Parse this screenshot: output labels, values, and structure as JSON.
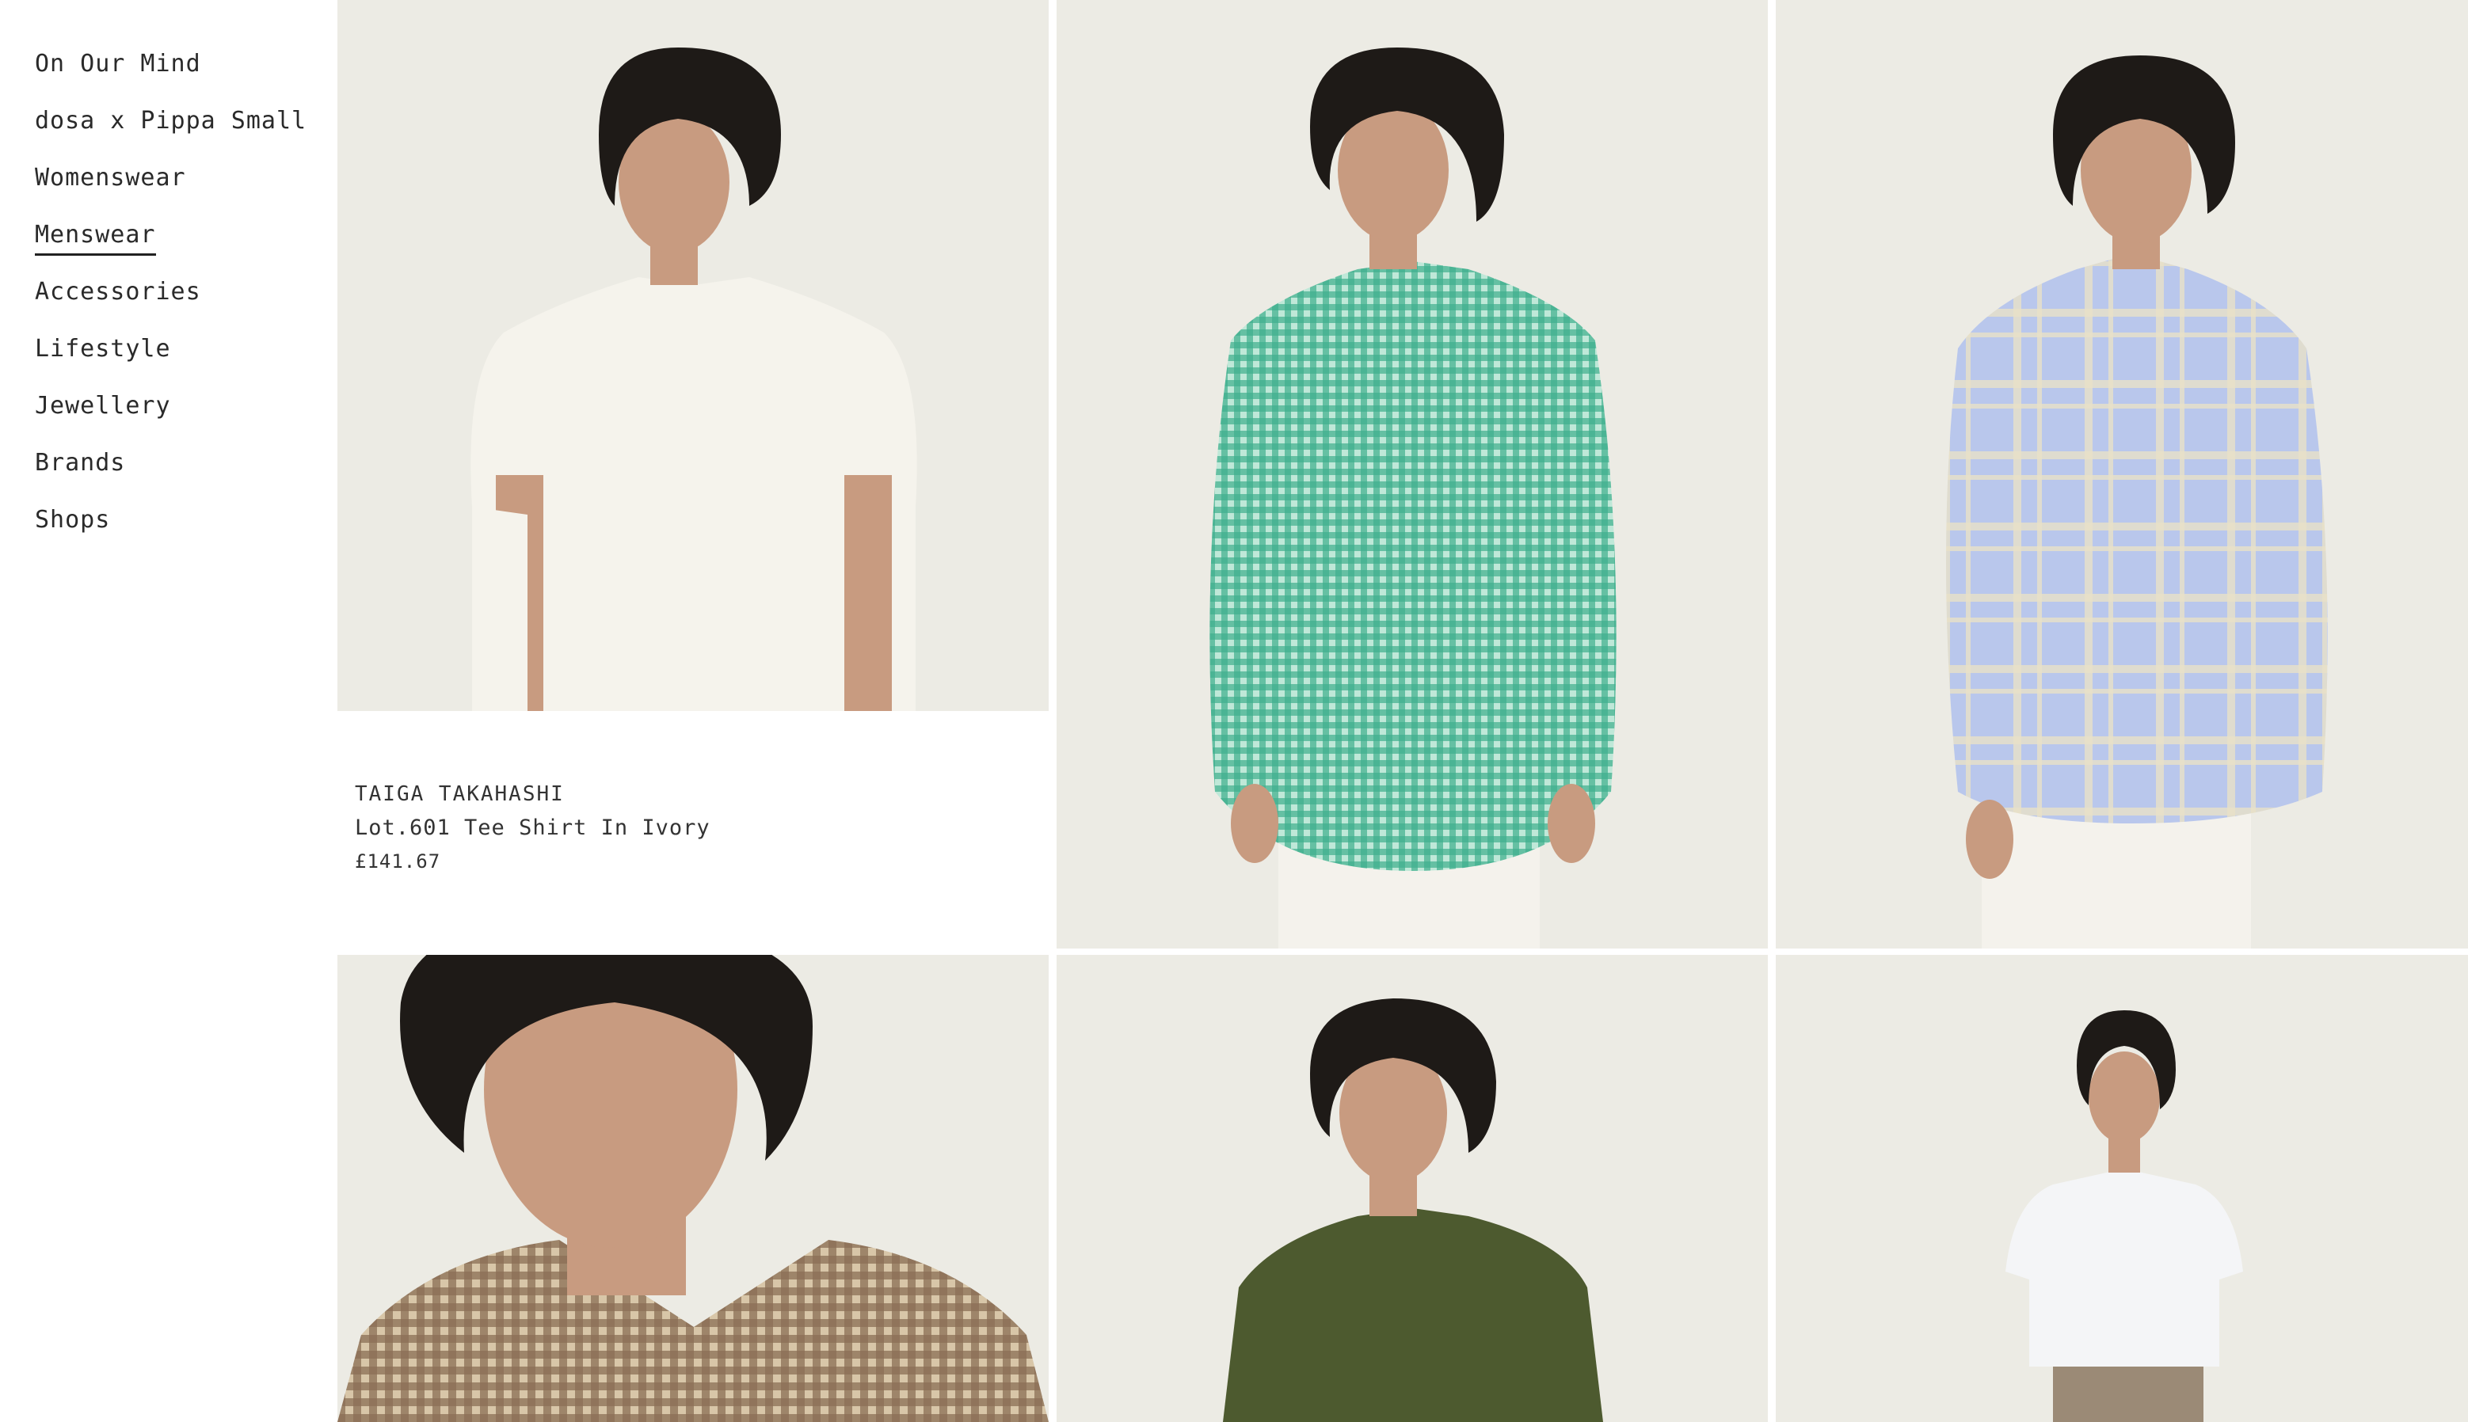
{
  "nav": {
    "items": [
      {
        "label": "On Our Mind"
      },
      {
        "label": "dosa x Pippa Small"
      },
      {
        "label": "Womenswear"
      },
      {
        "label": "Menswear"
      },
      {
        "label": "Accessories"
      },
      {
        "label": "Lifestyle"
      },
      {
        "label": "Jewellery"
      },
      {
        "label": "Brands"
      },
      {
        "label": "Shops"
      }
    ],
    "active_index": 3
  },
  "products": [
    {
      "brand": "TAIGA TAKAHASHI",
      "name": "Lot.601 Tee Shirt In Ivory",
      "price": "£141.67",
      "garment_color": "#f5f3ec"
    },
    {
      "garment_color": "#3fb08e"
    },
    {
      "garment_color": "#b9c7ec"
    },
    {
      "garment_color": "#8a6e55"
    },
    {
      "garment_color": "#4d5a2f"
    },
    {
      "garment_color": "#f4f5f7"
    }
  ],
  "colors": {
    "tile_background": "#ecebe4",
    "hair": "#1e1a17",
    "skin": "#c89b80"
  }
}
